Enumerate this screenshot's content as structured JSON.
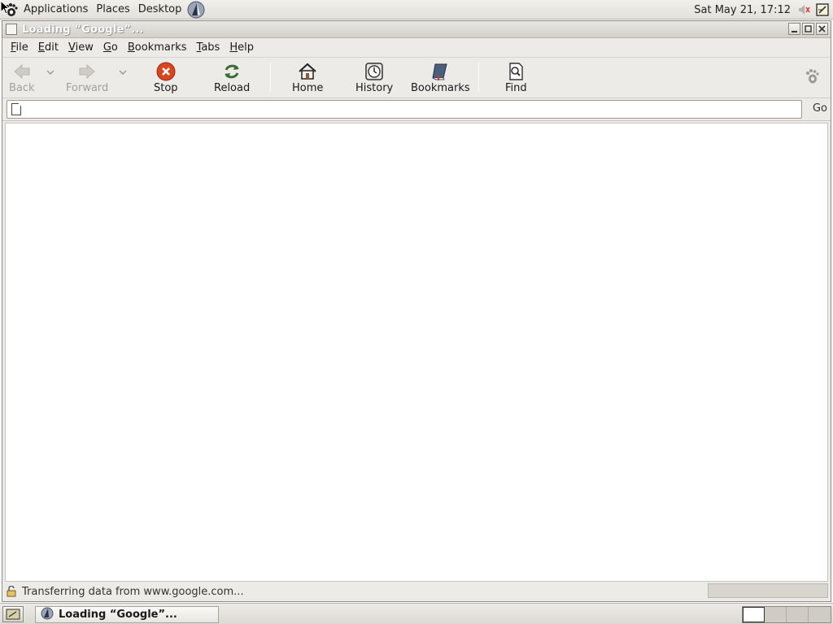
{
  "top_panel": {
    "menus": [
      "Applications",
      "Places",
      "Desktop"
    ],
    "clock": "Sat May 21, 17:12",
    "icons": [
      "gnome-foot-icon",
      "browser-launcher-icon",
      "volume-icon",
      "notes-icon"
    ]
  },
  "window": {
    "title": "Loading “Google”...",
    "controls": [
      "minimize-icon",
      "maximize-icon",
      "close-icon"
    ]
  },
  "menubar": {
    "items": [
      {
        "mnemonic": "F",
        "rest": "ile"
      },
      {
        "mnemonic": "E",
        "rest": "dit"
      },
      {
        "mnemonic": "V",
        "rest": "iew"
      },
      {
        "mnemonic": "G",
        "rest": "o"
      },
      {
        "mnemonic": "B",
        "rest": "ookmarks"
      },
      {
        "mnemonic": "T",
        "rest": "abs"
      },
      {
        "mnemonic": "H",
        "rest": "elp"
      }
    ]
  },
  "toolbar": {
    "back": "Back",
    "forward": "Forward",
    "stop": "Stop",
    "reload": "Reload",
    "home": "Home",
    "history": "History",
    "bookmarks": "Bookmarks",
    "find": "Find",
    "throbber_icon": "gnome-foot-throbber-icon"
  },
  "location": {
    "value": "",
    "go_label": "Go"
  },
  "status": {
    "text": "Transferring data from www.google.com...",
    "progress": 0.0
  },
  "taskbar": {
    "task_label": "Loading “Google”...",
    "workspaces": 4,
    "active_workspace": 1
  },
  "colors": {
    "panel_bg": "#e4e1dc",
    "stop_red": "#d7461f",
    "content_bg": "#ffffff"
  }
}
